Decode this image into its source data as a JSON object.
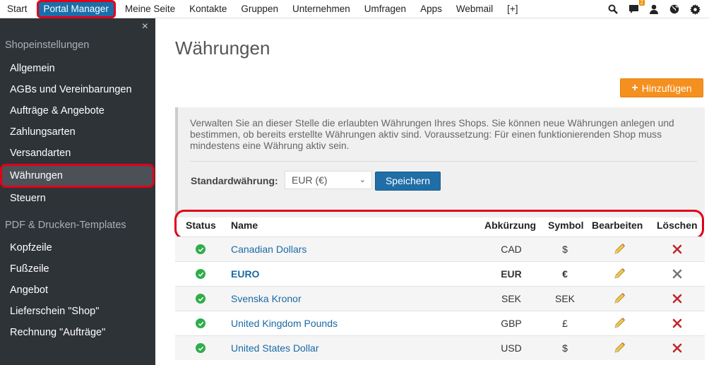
{
  "topnav": {
    "items": [
      "Start",
      "Portal Manager",
      "Meine Seite",
      "Kontakte",
      "Gruppen",
      "Unternehmen",
      "Umfragen",
      "Apps",
      "Webmail",
      "[+]"
    ],
    "icons": [
      "search-icon",
      "chat-icon",
      "user-icon",
      "globe-icon",
      "gear-icon"
    ],
    "chat_badge": "2"
  },
  "sidebar": {
    "close": "×",
    "section1": "Shopeinstellungen",
    "items1": [
      "Allgemein",
      "AGBs und Vereinbarungen",
      "Aufträge & Angebote",
      "Zahlungsarten",
      "Versandarten",
      "Währungen",
      "Steuern"
    ],
    "section2": "PDF & Drucken-Templates",
    "items2": [
      "Kopfzeile",
      "Fußzeile",
      "Angebot",
      "Lieferschein \"Shop\"",
      "Rechnung \"Aufträge\""
    ]
  },
  "main": {
    "title": "Währungen",
    "add_label": "Hinzufügen",
    "info_text": "Verwalten Sie an dieser Stelle die erlaubten Währungen Ihres Shops. Sie können neue Währungen anlegen und bestimmen, ob bereits erstellte Währungen aktiv sind. Voraussetzung: Für einen funktionierenden Shop muss mindestens eine Währung aktiv sein.",
    "std_label": "Standardwährung:",
    "std_value": "EUR (€)",
    "save_label": "Speichern"
  },
  "table": {
    "headers": [
      "Status",
      "Name",
      "Abkürzung",
      "Symbol",
      "Bearbeiten",
      "Löschen"
    ],
    "rows": [
      {
        "name": "Canadian Dollars",
        "abbr": "CAD",
        "symbol": "$",
        "default": false
      },
      {
        "name": "EURO",
        "abbr": "EUR",
        "symbol": "€",
        "default": true
      },
      {
        "name": "Svenska Kronor",
        "abbr": "SEK",
        "symbol": "SEK",
        "default": false
      },
      {
        "name": "United Kingdom Pounds",
        "abbr": "GBP",
        "symbol": "£",
        "default": false
      },
      {
        "name": "United States Dollar",
        "abbr": "USD",
        "symbol": "$",
        "default": false
      }
    ]
  },
  "colors": {
    "primary": "#1f6ea8",
    "accent": "#f5901e",
    "sidebar_bg": "#2e3338",
    "highlight": "#e0001a",
    "active_status": "#2eae4a"
  }
}
